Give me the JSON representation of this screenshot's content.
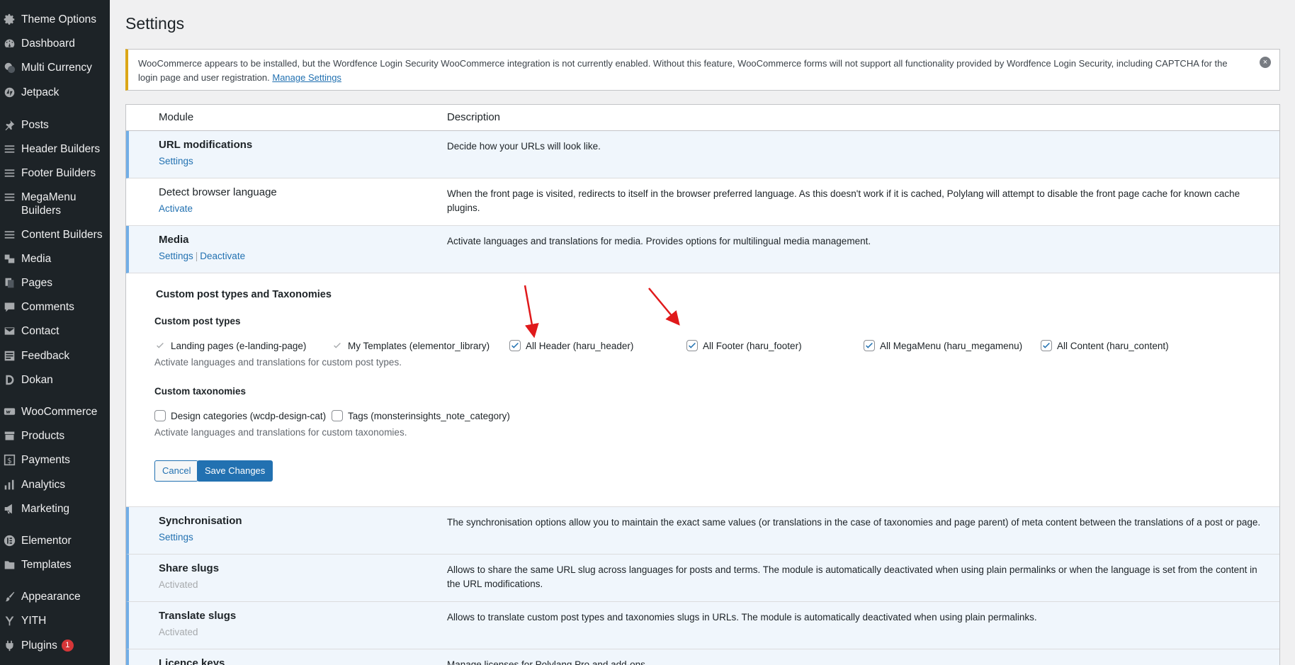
{
  "sidebar": {
    "items": [
      {
        "label": "Theme Options",
        "icon": "gear-icon"
      },
      {
        "label": "Dashboard",
        "icon": "dashboard-icon"
      },
      {
        "label": "Multi Currency",
        "icon": "currency-icon"
      },
      {
        "label": "Jetpack",
        "icon": "jetpack-icon"
      },
      {
        "label": "Posts",
        "icon": "pin-icon"
      },
      {
        "label": "Header Builders",
        "icon": "menu-lines-icon"
      },
      {
        "label": "Footer Builders",
        "icon": "menu-lines-icon"
      },
      {
        "label": "MegaMenu Builders",
        "icon": "menu-lines-icon"
      },
      {
        "label": "Content Builders",
        "icon": "menu-lines-icon"
      },
      {
        "label": "Media",
        "icon": "media-icon"
      },
      {
        "label": "Pages",
        "icon": "pages-icon"
      },
      {
        "label": "Comments",
        "icon": "comment-icon"
      },
      {
        "label": "Contact",
        "icon": "mail-icon"
      },
      {
        "label": "Feedback",
        "icon": "feedback-icon"
      },
      {
        "label": "Dokan",
        "icon": "dokan-icon"
      },
      {
        "label": "WooCommerce",
        "icon": "woo-icon"
      },
      {
        "label": "Products",
        "icon": "archive-icon"
      },
      {
        "label": "Payments",
        "icon": "dollar-icon"
      },
      {
        "label": "Analytics",
        "icon": "bar-chart-icon"
      },
      {
        "label": "Marketing",
        "icon": "megaphone-icon"
      },
      {
        "label": "Elementor",
        "icon": "elementor-icon"
      },
      {
        "label": "Templates",
        "icon": "folder-icon"
      },
      {
        "label": "Appearance",
        "icon": "brush-icon"
      },
      {
        "label": "YITH",
        "icon": "yith-icon"
      },
      {
        "label": "Plugins",
        "icon": "plug-icon",
        "badge": "1"
      }
    ]
  },
  "page": {
    "title": "Settings"
  },
  "notice": {
    "text": "WooCommerce appears to be installed, but the Wordfence Login Security WooCommerce integration is not currently enabled. Without this feature, WooCommerce forms will not support all functionality provided by Wordfence Login Security, including CAPTCHA for the login page and user registration.",
    "link": "Manage Settings",
    "dismiss": "×"
  },
  "table": {
    "headers": {
      "module": "Module",
      "description": "Description"
    },
    "rows": {
      "url": {
        "name": "URL modifications",
        "actions": [
          "Settings"
        ],
        "description": "Decide how your URLs will look like."
      },
      "browser": {
        "name": "Detect browser language",
        "actions": [
          "Activate"
        ],
        "description": "When the front page is visited, redirects to itself in the browser preferred language. As this doesn't work if it is cached, Polylang will attempt to disable the front page cache for known cache plugins."
      },
      "media": {
        "name": "Media",
        "actions": [
          "Settings",
          "Deactivate"
        ],
        "separator": "|",
        "description": "Activate languages and translations for media. Provides options for multilingual media management."
      },
      "sync": {
        "name": "Synchronisation",
        "actions": [
          "Settings"
        ],
        "description": "The synchronisation options allow you to maintain the exact same values (or translations in the case of taxonomies and page parent) of meta content between the translations of a post or page."
      },
      "share": {
        "name": "Share slugs",
        "status": "Activated",
        "description": "Allows to share the same URL slug across languages for posts and terms. The module is automatically deactivated when using plain permalinks or when the language is set from the content in the URL modifications."
      },
      "translate": {
        "name": "Translate slugs",
        "status": "Activated",
        "description": "Allows to translate custom post types and taxonomies slugs in URLs. The module is automatically deactivated when using plain permalinks."
      },
      "licence": {
        "name": "Licence keys",
        "description": "Manage licenses for Polylang Pro and add-ons."
      }
    }
  },
  "cpt_panel": {
    "title": "Custom post types and Taxonomies",
    "post_types_heading": "Custom post types",
    "post_types": [
      {
        "label": "Landing pages (e-landing-page)",
        "checked": true,
        "disabled": true
      },
      {
        "label": "My Templates (elementor_library)",
        "checked": true,
        "disabled": true
      },
      {
        "label": "All Header (haru_header)",
        "checked": true,
        "disabled": false
      },
      {
        "label": "All Footer (haru_footer)",
        "checked": true,
        "disabled": false
      },
      {
        "label": "All MegaMenu (haru_megamenu)",
        "checked": true,
        "disabled": false
      },
      {
        "label": "All Content (haru_content)",
        "checked": true,
        "disabled": false
      }
    ],
    "post_types_help": "Activate languages and translations for custom post types.",
    "taxonomies_heading": "Custom taxonomies",
    "taxonomies": [
      {
        "label": "Design categories (wcdp-design-cat)",
        "checked": false
      },
      {
        "label": "Tags (monsterinsights_note_category)",
        "checked": false
      }
    ],
    "taxonomies_help": "Activate languages and translations for custom taxonomies.",
    "cancel_label": "Cancel",
    "save_label": "Save Changes"
  },
  "colors": {
    "accent": "#2271b1",
    "sidebar": "#1d2327",
    "notice_warning": "#dba617",
    "active_row": "#f0f6fc",
    "annotation_arrow": "#e0191b"
  }
}
